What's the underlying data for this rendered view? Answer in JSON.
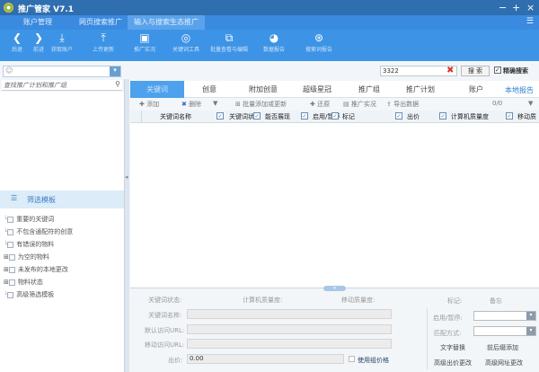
{
  "window": {
    "title": "推广管家 V7.1",
    "minimize": "−",
    "maximize": "+",
    "close": "×",
    "menu": "☰"
  },
  "menu_tabs": [
    {
      "label": "账户管理"
    },
    {
      "label": "网页搜索推广"
    },
    {
      "label": "输入与搜索生态推广",
      "active": true
    }
  ],
  "toolbar": [
    {
      "icon": "back-icon",
      "glyph": "❮",
      "label": "后退"
    },
    {
      "icon": "forward-icon",
      "glyph": "❯",
      "label": "前进"
    },
    {
      "icon": "download-icon",
      "glyph": "⤓",
      "label": "获取账户"
    },
    {
      "icon": "upload-icon",
      "glyph": "⤒",
      "label": "上传更新"
    },
    {
      "icon": "monitor-icon",
      "glyph": "▣",
      "label": "推广实况"
    },
    {
      "icon": "target-icon",
      "glyph": "◎",
      "label": "关键词工具"
    },
    {
      "icon": "expand-icon",
      "glyph": "⧉",
      "label": "批量查看与编辑"
    },
    {
      "icon": "pie-chart-icon",
      "glyph": "◕",
      "label": "数据报告"
    },
    {
      "icon": "search-report-icon",
      "glyph": "⊛",
      "label": "搜索词报告"
    }
  ],
  "left": {
    "search_placeholder": "查找推广计划和推广组",
    "filter_title": "筛选模板",
    "tree": [
      {
        "label": "重要的关键词"
      },
      {
        "label": "不包含通配符的创意"
      },
      {
        "label": "有错误的物料"
      },
      {
        "label": "为空的物料",
        "expandable": true
      },
      {
        "label": "未发布的本地更改",
        "expandable": true
      },
      {
        "label": "物料状态",
        "expandable": true
      },
      {
        "label": "高级筛选模板"
      }
    ]
  },
  "search": {
    "value": "3322",
    "button": "搜 索",
    "exact_label": "精确搜索",
    "exact_checked": true
  },
  "content_tabs": [
    {
      "label": "关键词",
      "active": true
    },
    {
      "label": "创意"
    },
    {
      "label": "附加创意"
    },
    {
      "label": "超级星冠"
    },
    {
      "label": "推广组"
    },
    {
      "label": "推广计划"
    },
    {
      "label": "账户"
    }
  ],
  "local_report": "本地报告",
  "actions": {
    "add": "添加",
    "delete": "删除",
    "batch": "批量添加或更新",
    "restore": "还原",
    "preview": "推广实况",
    "export": "导出数据",
    "count": "0/0"
  },
  "columns": [
    "关键词名称",
    "关键词状态",
    "能否展现",
    "启用/暂停",
    "标记",
    "出价",
    "计算机质量度",
    "移动质"
  ],
  "form": {
    "status_label": "关键词状态:",
    "pc_quality_label": "计算机质量度:",
    "mobile_quality_label": "移动质量度:",
    "name_label": "关键词名称:",
    "url_label": "默认访问URL:",
    "murl_label": "移动访问URL:",
    "bid_label": "出价:",
    "bid_value": "0.00",
    "use_group_price": "使用组价格",
    "mark_label": "标记:",
    "note": "备忘",
    "enable_label": "启用/暂停:",
    "match_label": "匹配方式:",
    "text_replace": "文字替换",
    "prefix_suffix": "前后缀添加",
    "adv_bid": "高级出价更改",
    "adv_url": "高级网址更改"
  },
  "colors": {
    "title": "#2f6fb0",
    "toolbar": "#3d94e6",
    "active_tab": "#4ea1ec"
  }
}
